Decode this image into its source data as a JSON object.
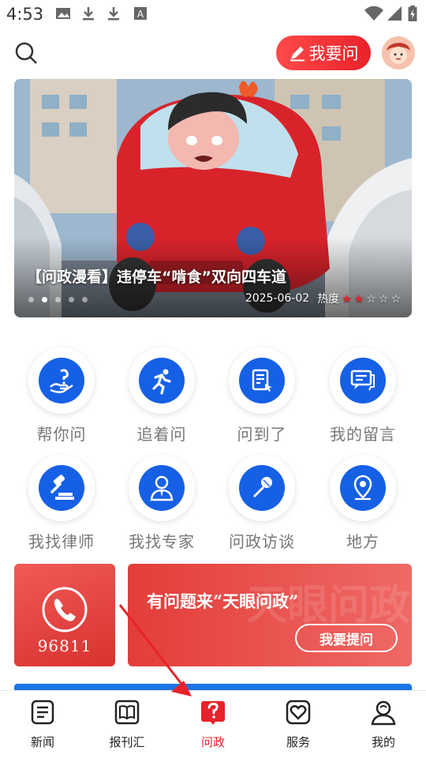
{
  "status_bar": {
    "time": "4:53"
  },
  "header": {
    "ask_button": "我要问",
    "icons": [
      "search-icon",
      "pen-icon",
      "avatar"
    ]
  },
  "banner": {
    "title": "【问政漫看】违停车“啃食”双向四车道",
    "date": "2025-06-02",
    "heat_label": "热度",
    "heat_rating": 2,
    "heat_max": 5,
    "slide_count": 5,
    "active_slide": 1
  },
  "grid": {
    "items": [
      {
        "label": "帮你问",
        "icon": "help-ask-icon"
      },
      {
        "label": "追着问",
        "icon": "running-icon"
      },
      {
        "label": "问到了",
        "icon": "document-touch-icon"
      },
      {
        "label": "我的留言",
        "icon": "message-icon"
      },
      {
        "label": "我找律师",
        "icon": "gavel-icon"
      },
      {
        "label": "我找专家",
        "icon": "expert-icon"
      },
      {
        "label": "问政访谈",
        "icon": "microphone-icon"
      },
      {
        "label": "地方",
        "icon": "location-icon"
      }
    ]
  },
  "hotline": {
    "number": "96811"
  },
  "promo": {
    "slogan": "有问题来“天眼问政”",
    "button": "我要提问",
    "watermark": "天眼问政"
  },
  "tabs": [
    {
      "label": "新闻",
      "icon": "news-icon"
    },
    {
      "label": "报刊汇",
      "icon": "book-icon"
    },
    {
      "label": "问政",
      "icon": "question-icon",
      "active": true
    },
    {
      "label": "服务",
      "icon": "heart-icon"
    },
    {
      "label": "我的",
      "icon": "user-icon"
    }
  ],
  "colors": {
    "accent": "#e8222a",
    "icon_blue": "#1660e6",
    "grid_label": "#777777"
  }
}
